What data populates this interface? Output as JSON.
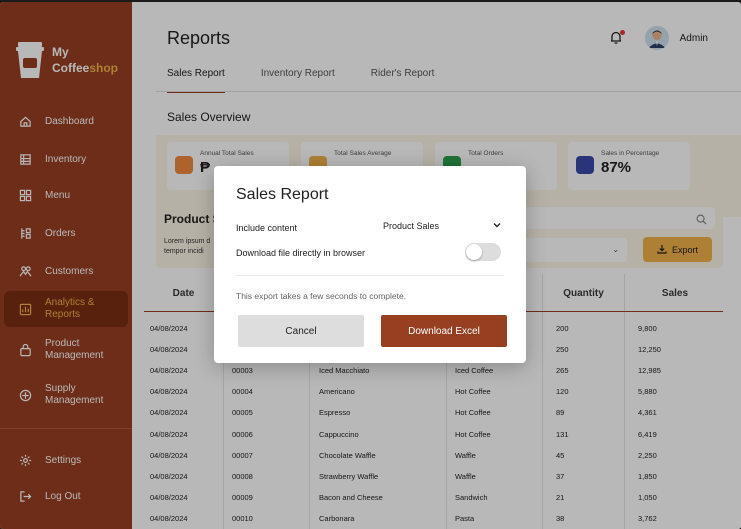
{
  "sidebar": {
    "logo_line1": "My",
    "logo_line2a": "Coffee",
    "logo_line2b": "shop",
    "items": [
      {
        "label": "Dashboard",
        "icon": "home-icon"
      },
      {
        "label": "Inventory",
        "icon": "inventory-icon"
      },
      {
        "label": "Menu",
        "icon": "menu-grid-icon"
      },
      {
        "label": "Orders",
        "icon": "orders-icon"
      },
      {
        "label": "Customers",
        "icon": "customers-icon"
      },
      {
        "label": "Analytics & Reports",
        "icon": "analytics-icon",
        "active": true
      },
      {
        "label": "Product Management",
        "icon": "product-icon"
      },
      {
        "label": "Supply Management",
        "icon": "supply-icon"
      }
    ],
    "bottom_items": [
      {
        "label": "Settings",
        "icon": "gear-icon"
      },
      {
        "label": "Log Out",
        "icon": "logout-icon"
      }
    ]
  },
  "header": {
    "title": "Reports",
    "user_name": "Admin"
  },
  "tabs": [
    "Sales Report",
    "Inventory Report",
    "Rider's Report"
  ],
  "overview": {
    "title": "Sales Overview",
    "cards": [
      {
        "label": "Annual Total Sales",
        "value": "₱",
        "color": "#f08a3a"
      },
      {
        "label": "Total Sales Average",
        "value": "",
        "color": "#f0b24a"
      },
      {
        "label": "Total Orders",
        "value": "",
        "color": "#2e9e4f"
      },
      {
        "label": "Sales in Percentage",
        "value": "87%",
        "color": "#3b4aa8"
      }
    ]
  },
  "filter": {
    "title": "Product S",
    "desc": "Lorem ipsum d tempor incidi",
    "export_label": "Export"
  },
  "table": {
    "headers": [
      "Date",
      "",
      "",
      "",
      "Quantity",
      "Sales"
    ],
    "rows": [
      [
        "04/08/2024",
        "",
        "",
        "",
        "200",
        "9,800"
      ],
      [
        "04/08/2024",
        "",
        "",
        "",
        "250",
        "12,250"
      ],
      [
        "04/08/2024",
        "00003",
        "Iced Macchiato",
        "Iced Coffee",
        "265",
        "12,985"
      ],
      [
        "04/08/2024",
        "00004",
        "Americano",
        "Hot Coffee",
        "120",
        "5,880"
      ],
      [
        "04/08/2024",
        "00005",
        "Espresso",
        "Hot Coffee",
        "89",
        "4,361"
      ],
      [
        "04/08/2024",
        "00006",
        "Cappuccino",
        "Hot Coffee",
        "131",
        "6,419"
      ],
      [
        "04/08/2024",
        "00007",
        "Chocolate Waffle",
        "Waffle",
        "45",
        "2,250"
      ],
      [
        "04/08/2024",
        "00008",
        "Strawberry Waffle",
        "Waffle",
        "37",
        "1,850"
      ],
      [
        "04/08/2024",
        "00009",
        "Bacon and Cheese",
        "Sandwich",
        "21",
        "1,050"
      ],
      [
        "04/08/2024",
        "00010",
        "Carbonara",
        "Pasta",
        "38",
        "3,762"
      ]
    ]
  },
  "modal": {
    "title": "Sales Report",
    "include_label": "Include content",
    "include_value": "Product Sales",
    "download_label": "Download file directly in browser",
    "download_toggle_on": false,
    "note": "This export takes a few seconds to complete.",
    "cancel_label": "Cancel",
    "download_button": "Download Excel"
  },
  "colors": {
    "brand": "#983f22",
    "accent": "#f0b24a"
  }
}
